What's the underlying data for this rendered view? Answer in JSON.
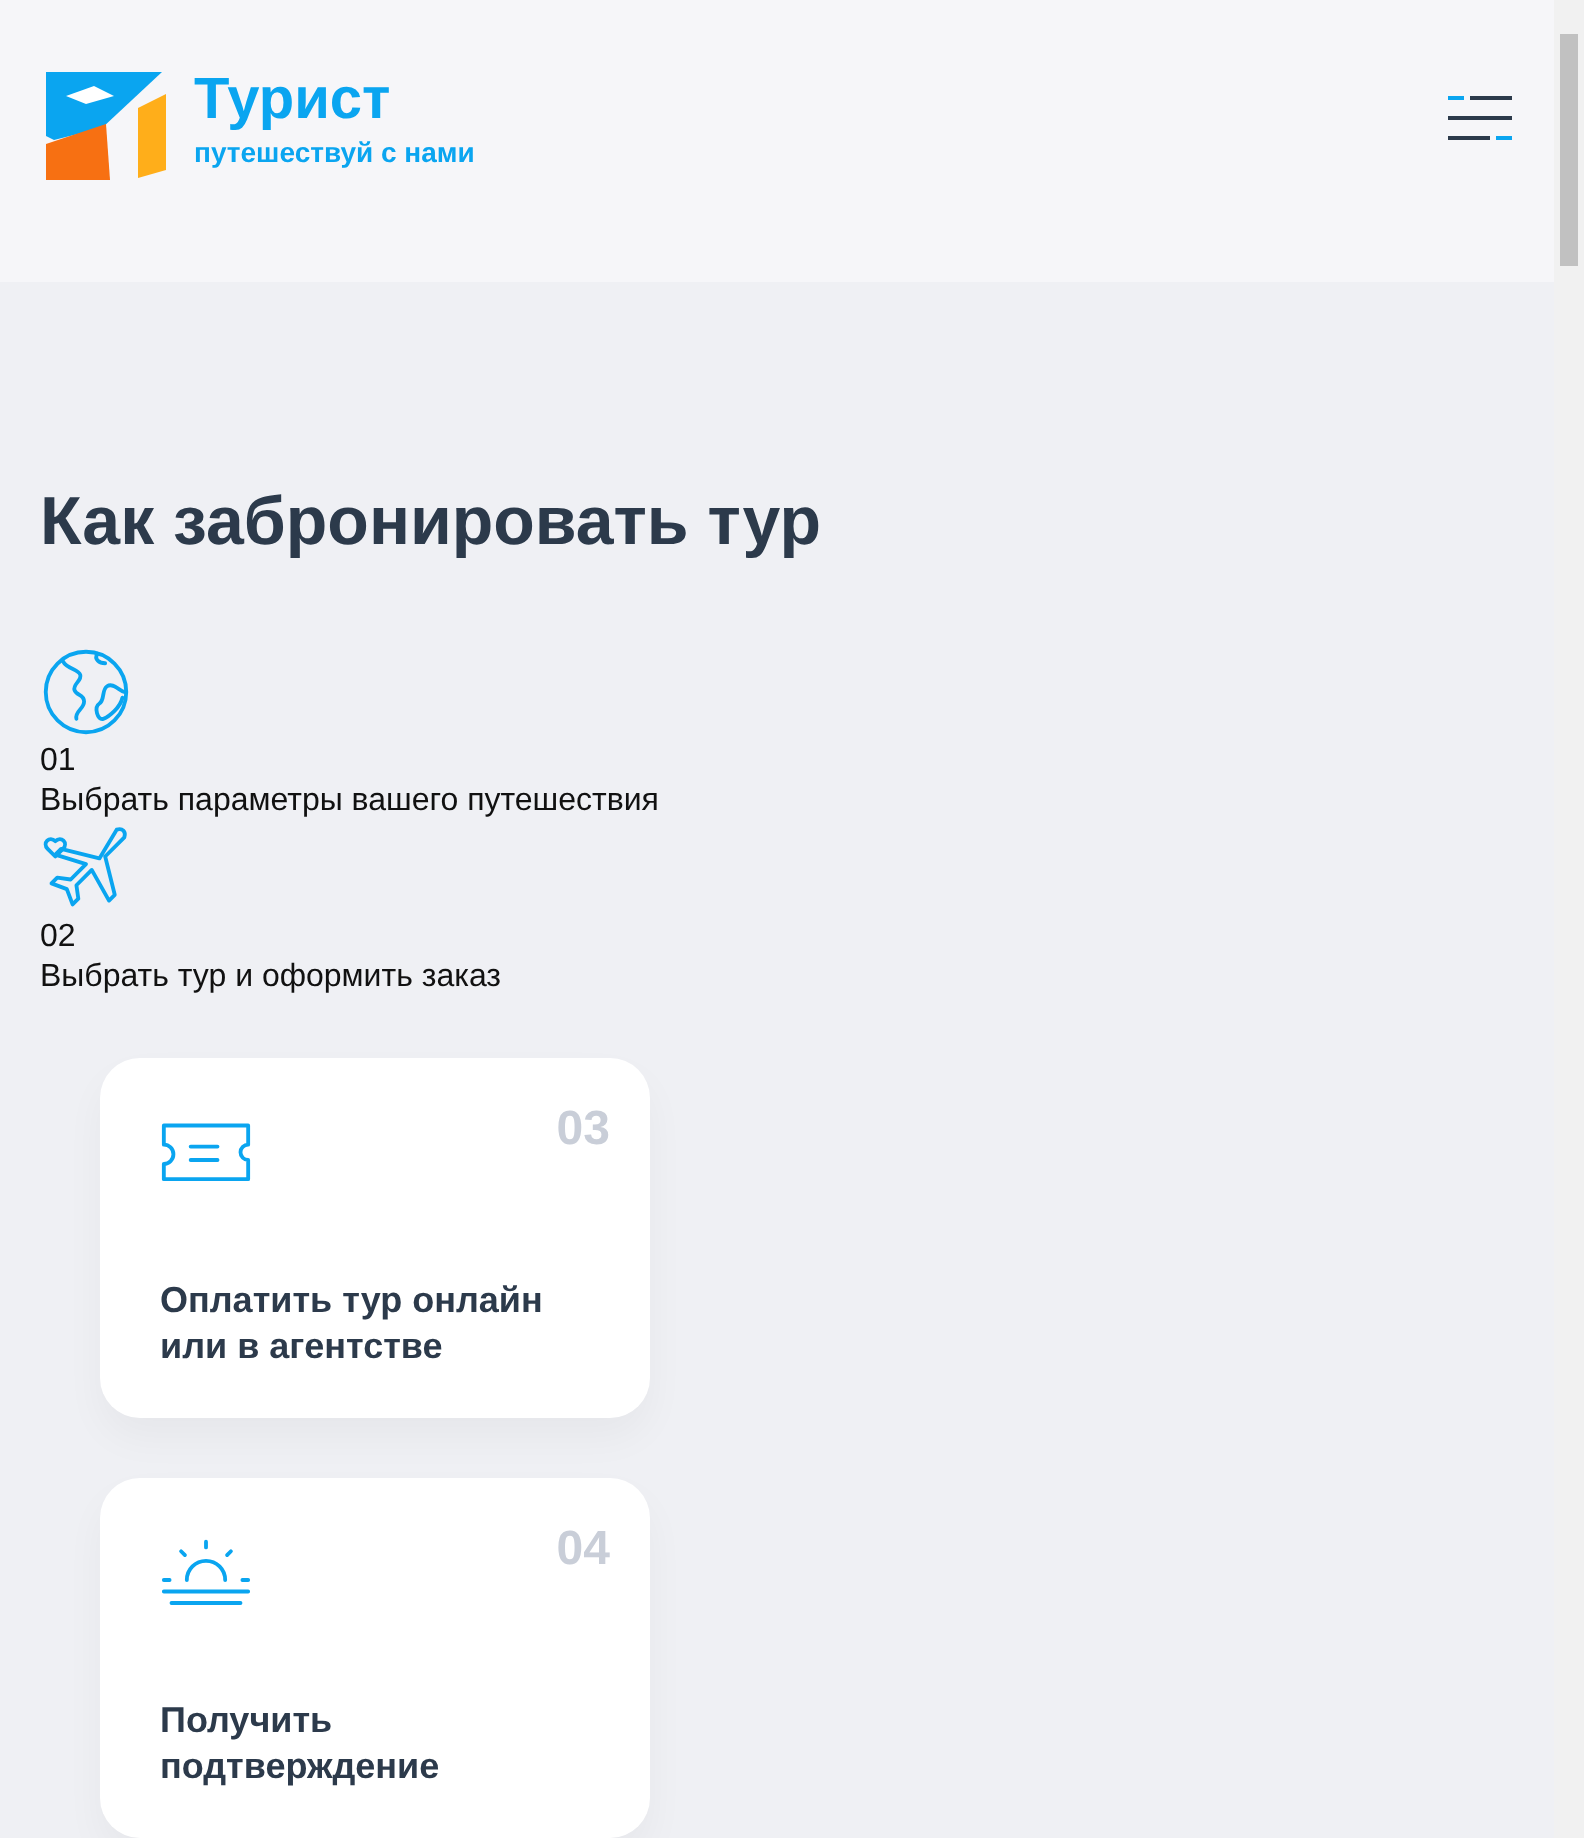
{
  "header": {
    "logo_title": "Турист",
    "logo_tagline": "путешествуй с нами"
  },
  "section": {
    "heading": "Как забронировать тур",
    "steps": [
      {
        "kind": "plain",
        "number": "01",
        "text": "Выбрать параметры вашего путешествия"
      },
      {
        "kind": "plain",
        "number": "02",
        "text": "Выбрать тур и оформить заказ"
      },
      {
        "kind": "card",
        "number": "03",
        "text": "Оплатить тур онлайн или в агентстве"
      },
      {
        "kind": "card",
        "number": "04",
        "text": "Получить подтверждение"
      }
    ]
  }
}
